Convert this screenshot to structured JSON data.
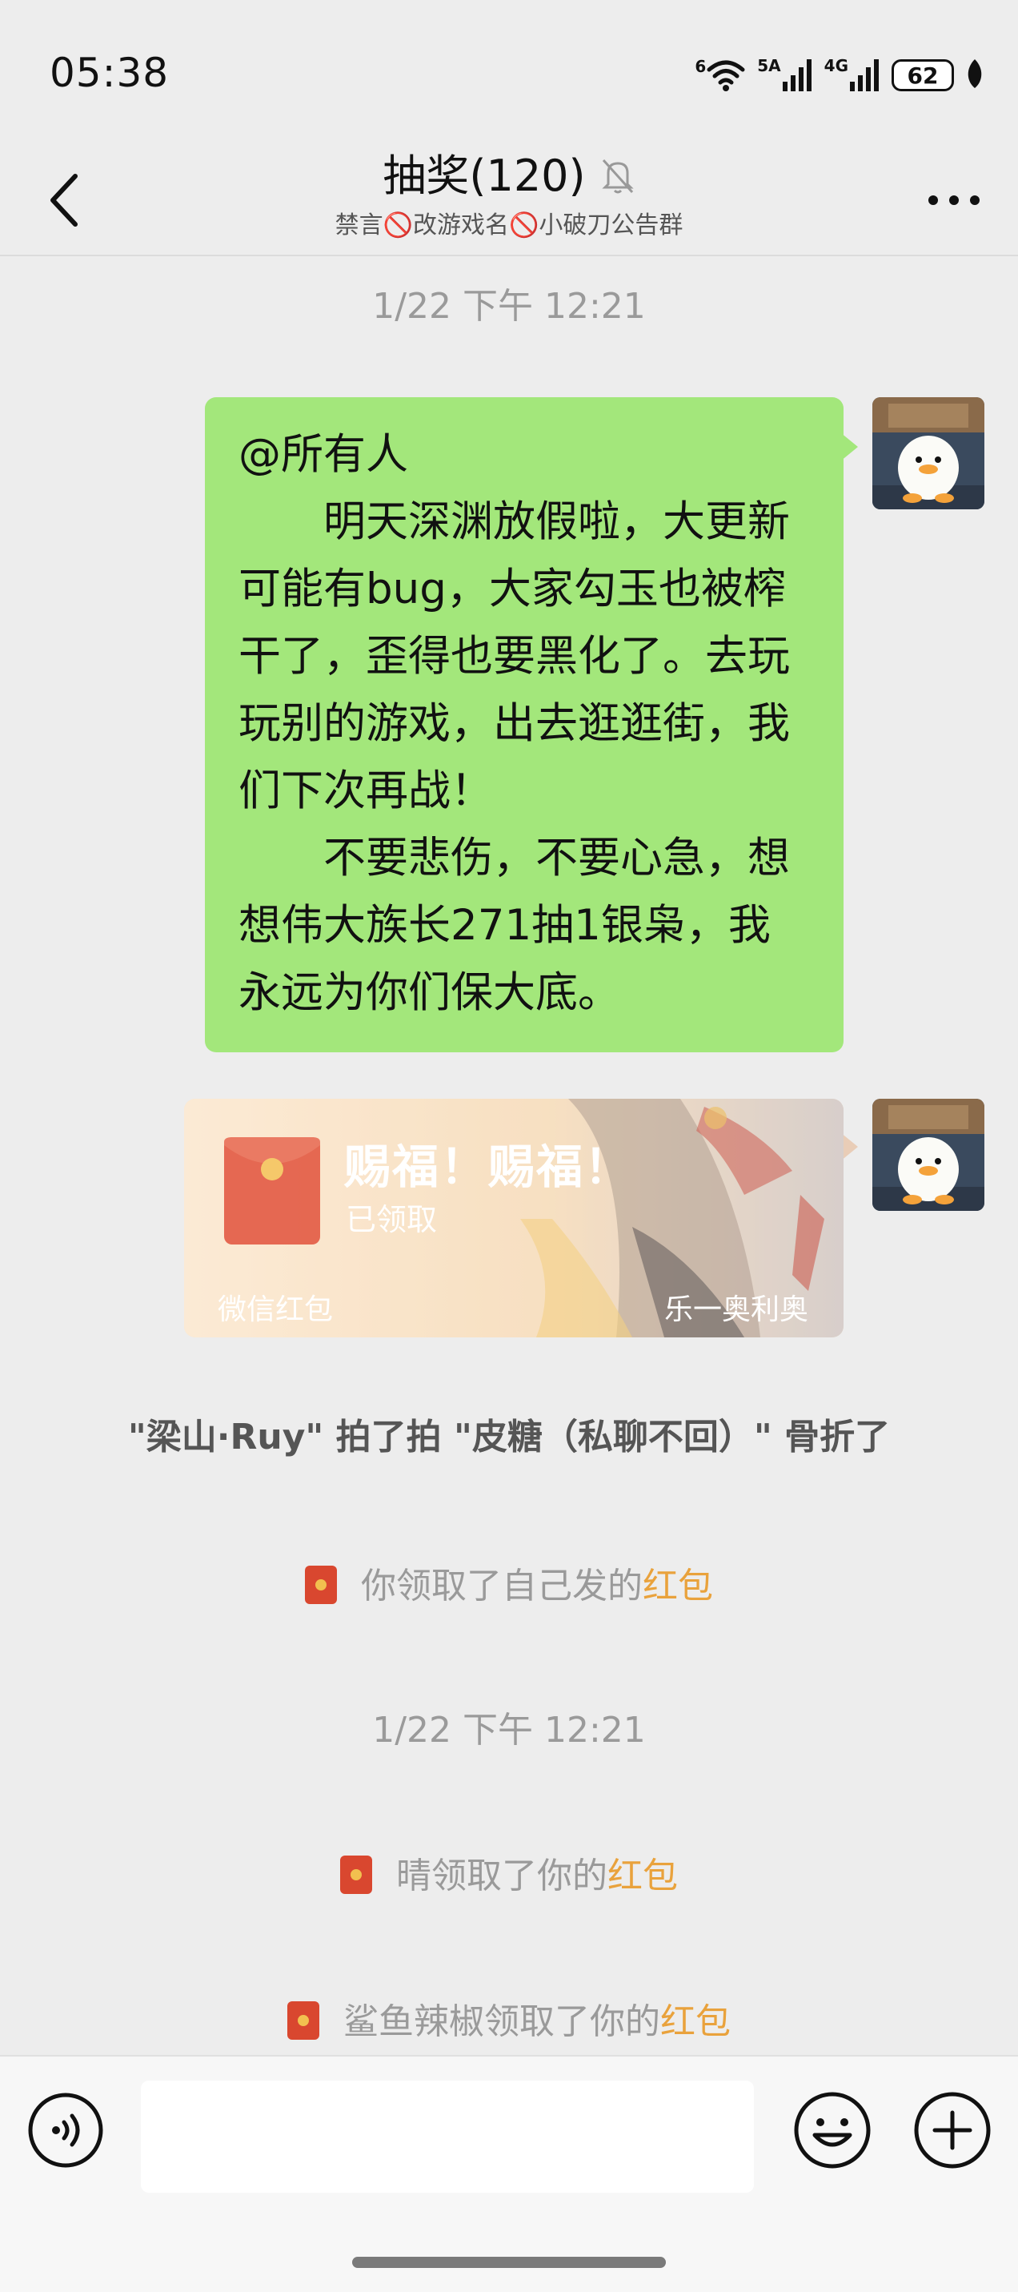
{
  "status_bar": {
    "time": "05:38",
    "wifi_label": "6",
    "sim1_label": "5A",
    "sim2_label": "4G",
    "battery": "62"
  },
  "header": {
    "title": "抽奖(120)",
    "subtitle": "禁言🚫改游戏名🚫小破刀公告群",
    "back_icon": "chevron-left-icon",
    "mute_icon": "bell-muted-icon",
    "more_icon": "more-dots-icon"
  },
  "messages": {
    "timestamp_1": "1/22 下午 12:21",
    "text_message": {
      "line1": "@所有人",
      "para1": "明天深渊放假啦，大更新可能有bug，大家勾玉也被榨干了，歪得也要黑化了。去玩玩别的游戏，出去逛逛街，我们下次再战！",
      "para2": "不要悲伤，不要心急，想想伟大族长271抽1银枭，我永远为你们保大底。"
    },
    "red_packet": {
      "title": "赐福！赐福！",
      "status": "已领取",
      "footer_left": "微信红包",
      "footer_right": "乐一奥利奥"
    },
    "pat_notice": "\"梁山·Ruy\" 拍了拍 \"皮糖（私聊不回）\" 骨折了",
    "sys_1": {
      "text": "你领取了自己发的",
      "link": "红包"
    },
    "timestamp_2": "1/22 下午 12:21",
    "sys_2": {
      "text": "晴领取了你的",
      "link": "红包"
    },
    "sys_3": {
      "text": "鲨鱼辣椒领取了你的",
      "link": "红包"
    }
  },
  "input_bar": {
    "voice_icon": "voice-icon",
    "input_value": "",
    "emoji_icon": "emoji-icon",
    "plus_icon": "plus-icon"
  },
  "colors": {
    "bubble_green": "#a3e77b",
    "highlight_orange": "#e9a23c",
    "background": "#ededed"
  }
}
